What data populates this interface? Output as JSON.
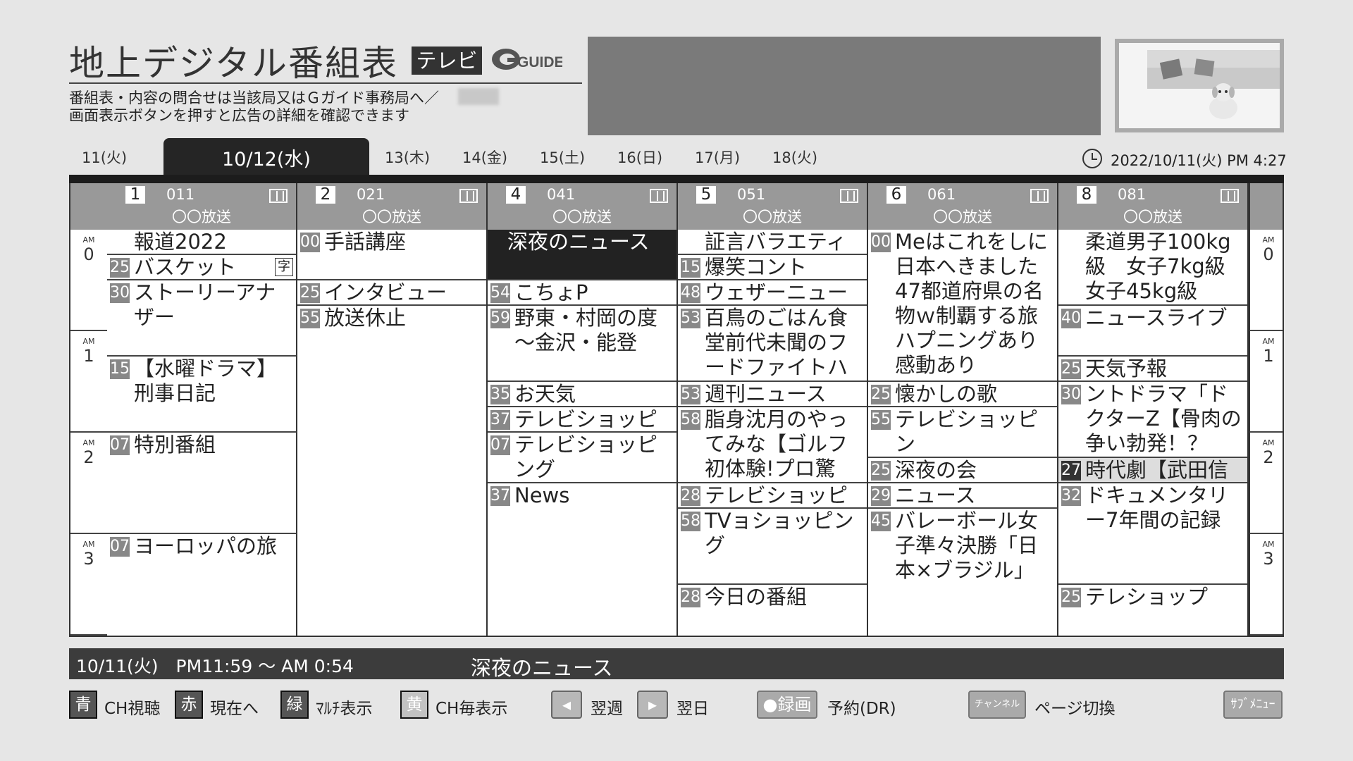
{
  "header": {
    "title": "地上デジタル番組表",
    "tv_badge": "テレビ",
    "logo_text": "GUIDE",
    "note1": "番組表・内容の問合せは当該局又はＧガイド事務局へ／",
    "note2": "画面表示ボタンを押すと広告の詳細を確認できます"
  },
  "dates": {
    "tabs": [
      "11(火)",
      "10/12(水)",
      "13(木)",
      "14(金)",
      "15(土)",
      "16(日)",
      "17(月)",
      "18(火)"
    ],
    "active_index": 1
  },
  "clock": "2022/10/11(火) PM 4:27",
  "channels": [
    {
      "num": "1",
      "code": "011",
      "name": "〇〇放送"
    },
    {
      "num": "2",
      "code": "021",
      "name": "〇〇放送"
    },
    {
      "num": "4",
      "code": "041",
      "name": "〇〇放送"
    },
    {
      "num": "5",
      "code": "051",
      "name": "〇〇放送"
    },
    {
      "num": "6",
      "code": "061",
      "name": "〇〇放送"
    },
    {
      "num": "8",
      "code": "081",
      "name": "〇〇放送"
    }
  ],
  "hours": [
    {
      "am": "AM",
      "h": "0"
    },
    {
      "am": "AM",
      "h": "1"
    },
    {
      "am": "AM",
      "h": "2"
    },
    {
      "am": "AM",
      "h": "3"
    }
  ],
  "programs": [
    [
      {
        "min": "",
        "title": "報道2022"
      },
      {
        "min": "25",
        "title": "バスケット",
        "sub": "字"
      },
      {
        "min": "30",
        "title": "ストーリーアナザー"
      },
      {
        "min": "15",
        "title": "【水曜ドラマ】刑事日記"
      },
      {
        "min": "07",
        "title": "特別番組"
      },
      {
        "min": "07",
        "title": "ヨーロッパの旅"
      }
    ],
    [
      {
        "min": "00",
        "title": "手話講座"
      },
      {
        "min": "25",
        "title": "インタビュー"
      },
      {
        "min": "55",
        "title": "放送休止"
      }
    ],
    [
      {
        "min": "",
        "title": "深夜のニュース"
      },
      {
        "min": "54",
        "title": "こちょP"
      },
      {
        "min": "59",
        "title": "野東・村岡の度～金沢・能登"
      },
      {
        "min": "35",
        "title": "お天気"
      },
      {
        "min": "37",
        "title": "テレビショッピン"
      },
      {
        "min": "07",
        "title": "テレビショッピング"
      },
      {
        "min": "37",
        "title": "News"
      }
    ],
    [
      {
        "min": "",
        "title": "証言バラエティ"
      },
      {
        "min": "15",
        "title": "爆笑コント"
      },
      {
        "min": "48",
        "title": "ウェザーニュース"
      },
      {
        "min": "53",
        "title": "百鳥のごはん食堂前代未聞のフードファイトハリウッド"
      },
      {
        "min": "53",
        "title": "週刊ニュース"
      },
      {
        "min": "58",
        "title": "脂身沈月のやってみな【ゴルフ初体験!プロ驚愕!】"
      },
      {
        "min": "28",
        "title": "テレビショッピン"
      },
      {
        "min": "58",
        "title": "TVョショッピング"
      },
      {
        "min": "28",
        "title": "今日の番組"
      }
    ],
    [
      {
        "min": "00",
        "title": "Meはこれをしに日本へきました47都道府県の名物ｗ制覇する旅ハプニングあり感動あり"
      },
      {
        "min": "25",
        "title": "懐かしの歌"
      },
      {
        "min": "55",
        "title": "テレビショッピン"
      },
      {
        "min": "25",
        "title": "深夜の会"
      },
      {
        "min": "29",
        "title": "ニュース"
      },
      {
        "min": "45",
        "title": "バレーボール女子準々決勝「日本×ブラジル」"
      }
    ],
    [
      {
        "min": "",
        "title": "柔道男子100kg級　女子7kg級女子45kg級"
      },
      {
        "min": "40",
        "title": "ニュースライブ"
      },
      {
        "min": "25",
        "title": "天気予報"
      },
      {
        "min": "30",
        "title": "ントドラマ「ドクターZ【骨肉の争い勃発！？"
      },
      {
        "min": "27",
        "title": "時代劇【武田信"
      },
      {
        "min": "32",
        "title": "ドキュメンタリー7年間の記録"
      },
      {
        "min": "25",
        "title": "テレショップ"
      }
    ]
  ],
  "info_bar": {
    "time": "10/11(火)　PM11:59 ～ AM 0:54",
    "title": "深夜のニュース"
  },
  "footer": {
    "blue_key": "青",
    "blue_label": "CH視聴",
    "red_key": "赤",
    "red_label": "現在へ",
    "green_key": "緑",
    "green_label": "ﾏﾙﾁ表示",
    "yellow_key": "黄",
    "yellow_label": "CH毎表示",
    "prev_label": "翌週",
    "next_label": "翌日",
    "rec_key": "●録画",
    "rec_label": "予約(DR)",
    "ch_key": "チャンネル",
    "ch_label": "ページ切換",
    "submenu": "ｻﾌﾞﾒﾆｭｰ"
  }
}
